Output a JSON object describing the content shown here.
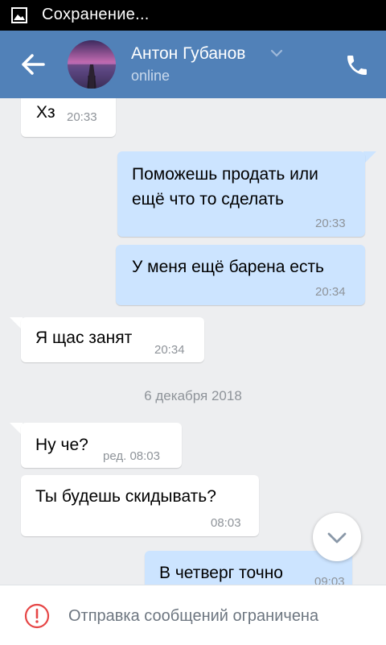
{
  "status_bar": {
    "text": "Сохранение...",
    "icon": "image-icon"
  },
  "header": {
    "name": "Антон Губанов",
    "status": "online",
    "back_icon": "arrow-left-icon",
    "call_icon": "phone-icon",
    "accent": "#5181b8"
  },
  "messages": [
    {
      "dir": "in",
      "text": "Хз",
      "time": "20:33"
    },
    {
      "dir": "out",
      "text": "Поможешь продать или",
      "text2": "ещё что то сделать",
      "time": "20:33"
    },
    {
      "dir": "out",
      "text": "У меня ещё барена есть",
      "time": "20:34"
    },
    {
      "dir": "in",
      "text": "Я щас занят",
      "time": "20:34"
    },
    {
      "dir": "in",
      "text": "Ну че?",
      "time": "ред. 08:03"
    },
    {
      "dir": "in",
      "text": "Ты будешь скидывать?",
      "time": "08:03"
    },
    {
      "dir": "out",
      "text": "В четверг точно",
      "time": "09:03"
    }
  ],
  "date_separator": "6 декабря 2018",
  "bottom_notice": "Отправка сообщений ограничена",
  "colors": {
    "incoming": "#ffffff",
    "outgoing": "#cce4ff",
    "background": "#edeef0"
  }
}
